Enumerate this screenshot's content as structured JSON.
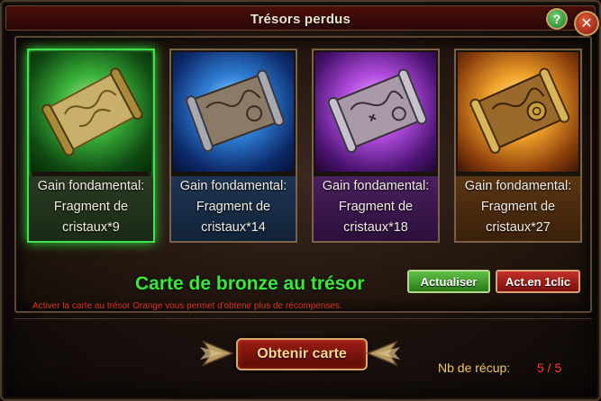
{
  "window": {
    "title": "Trésors perdus",
    "help_glyph": "?",
    "close_glyph": "✕"
  },
  "cards": [
    {
      "rarity": "green",
      "line1": "Gain fondamental:",
      "line2": "Fragment de",
      "line3": "cristaux*9",
      "selected": true
    },
    {
      "rarity": "blue",
      "line1": "Gain fondamental:",
      "line2": "Fragment de",
      "line3": "cristaux*14",
      "selected": false
    },
    {
      "rarity": "purple",
      "line1": "Gain fondamental:",
      "line2": "Fragment de",
      "line3": "cristaux*18",
      "selected": false
    },
    {
      "rarity": "orange",
      "line1": "Gain fondamental:",
      "line2": "Fragment de",
      "line3": "cristaux*27",
      "selected": false
    }
  ],
  "current_map": {
    "name": "Carte de bronze au trésor",
    "info": "Activer la carte au trésor Orange vous permet d'obtenir plus de récompenses."
  },
  "buttons": {
    "refresh_label": "Actualiser",
    "quick_refresh_label": "Act.en 1clic",
    "obtain_label": "Obtenir carte"
  },
  "collect": {
    "label": "Nb de récup:",
    "value": "5 / 5"
  },
  "colors": {
    "selected_border": "#3fe34f",
    "treasure_name": "#3ce83a",
    "info_text": "#d6371f",
    "collect_label": "#f0c860",
    "collect_value": "#ff3a2a"
  },
  "icons": {
    "card_art": "treasure-map-scroll",
    "help": "question-mark-icon",
    "close": "close-x-icon"
  }
}
